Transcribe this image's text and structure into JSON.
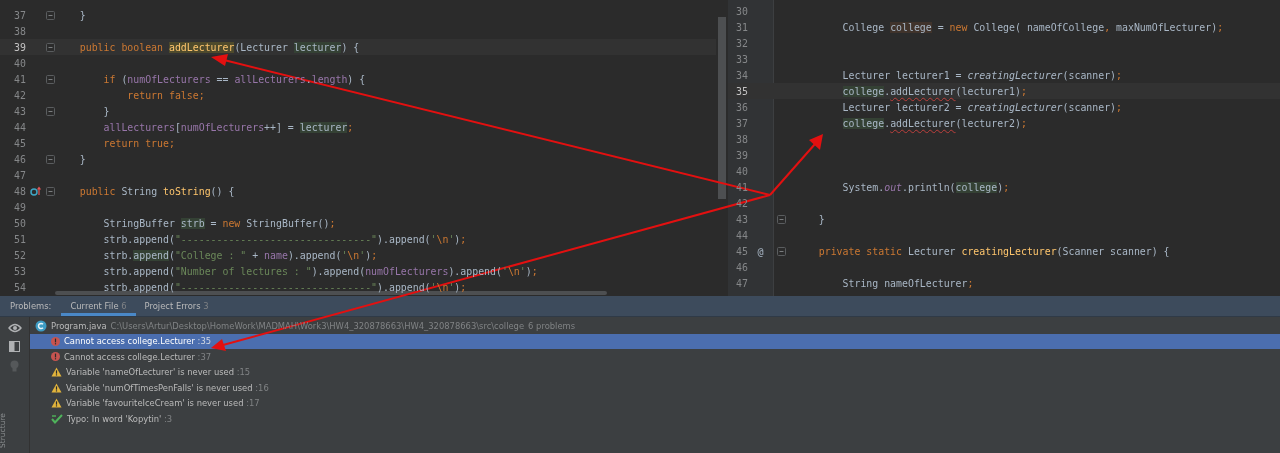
{
  "left_editor": {
    "lines": [
      {
        "number": "37",
        "current": false,
        "fold": true,
        "tokens": [
          {
            "t": "    }",
            "kind": "p"
          }
        ]
      },
      {
        "number": "38",
        "current": false,
        "fold": false
      },
      {
        "number": "39",
        "current": true,
        "fold": true,
        "tokens": [
          {
            "t": "    public boolean ",
            "kind": "kw"
          },
          {
            "t": "addLecturer",
            "kind": "mdecl"
          },
          {
            "t": "(Lecturer ",
            "kind": "p"
          },
          {
            "t": "lecturer",
            "kind": "usage"
          },
          {
            "t": ") {",
            "kind": "p"
          }
        ]
      },
      {
        "number": "40",
        "current": false,
        "fold": false
      },
      {
        "number": "41",
        "current": false,
        "fold": true,
        "tokens": [
          {
            "t": "        if ",
            "kind": "kw"
          },
          {
            "t": "(",
            "kind": "p"
          },
          {
            "t": "numOfLecturers",
            "kind": "f"
          },
          {
            "t": " == ",
            "kind": "p"
          },
          {
            "t": "allLecturers",
            "kind": "f"
          },
          {
            "t": ".",
            "kind": "p"
          },
          {
            "t": "length",
            "kind": "f"
          },
          {
            "t": ") {",
            "kind": "p"
          }
        ]
      },
      {
        "number": "42",
        "current": false,
        "fold": false,
        "tokens": [
          {
            "t": "            return false;",
            "kind": "kw"
          }
        ]
      },
      {
        "number": "43",
        "current": false,
        "fold": true,
        "tokens": [
          {
            "t": "        }",
            "kind": "p"
          }
        ]
      },
      {
        "number": "44",
        "current": false,
        "fold": false,
        "tokens": [
          {
            "t": "        allLecturers",
            "kind": "f"
          },
          {
            "t": "[",
            "kind": "p"
          },
          {
            "t": "numOfLecturers",
            "kind": "f"
          },
          {
            "t": "++] = ",
            "kind": "p"
          },
          {
            "t": "lecturer",
            "kind": "usage"
          },
          {
            "t": ";",
            "kind": "kw"
          }
        ]
      },
      {
        "number": "45",
        "current": false,
        "fold": false,
        "tokens": [
          {
            "t": "        return true;",
            "kind": "kw"
          }
        ]
      },
      {
        "number": "46",
        "current": false,
        "fold": true,
        "tokens": [
          {
            "t": "    }",
            "kind": "p"
          }
        ]
      },
      {
        "number": "47",
        "current": false,
        "fold": false
      },
      {
        "number": "48",
        "current": false,
        "fold": true,
        "gutter": {
          "kind": "override"
        },
        "tokens": [
          {
            "t": "    public ",
            "kind": "kw"
          },
          {
            "t": "String ",
            "kind": "p"
          },
          {
            "t": "toString",
            "kind": "m"
          },
          {
            "t": "() {",
            "kind": "p"
          }
        ]
      },
      {
        "number": "49",
        "current": false,
        "fold": false
      },
      {
        "number": "50",
        "current": false,
        "fold": false,
        "tokens": [
          {
            "t": "        StringBuffer ",
            "kind": "p"
          },
          {
            "t": "strb",
            "kind": "usage"
          },
          {
            "t": " = ",
            "kind": "p"
          },
          {
            "t": "new ",
            "kind": "kw"
          },
          {
            "t": "StringBuffer()",
            "kind": "p"
          },
          {
            "t": ";",
            "kind": "kw"
          }
        ]
      },
      {
        "number": "51",
        "current": false,
        "fold": false,
        "tokens": [
          {
            "t": "        strb.append(",
            "kind": "p"
          },
          {
            "t": "\"--------------------------------\"",
            "kind": "s"
          },
          {
            "t": ").append(",
            "kind": "p"
          },
          {
            "t": "'",
            "kind": "s"
          },
          {
            "t": "\\n",
            "kind": "kw"
          },
          {
            "t": "'",
            "kind": "s"
          },
          {
            "t": ")",
            "kind": "p"
          },
          {
            "t": ";",
            "kind": "kw"
          }
        ]
      },
      {
        "number": "52",
        "current": false,
        "fold": false,
        "tokens": [
          {
            "t": "        strb.",
            "kind": "p"
          },
          {
            "t": "append",
            "kind": "usage"
          },
          {
            "t": "(",
            "kind": "p"
          },
          {
            "t": "\"College : \"",
            "kind": "s"
          },
          {
            "t": " + ",
            "kind": "p"
          },
          {
            "t": "name",
            "kind": "f"
          },
          {
            "t": ").append(",
            "kind": "p"
          },
          {
            "t": "'",
            "kind": "s"
          },
          {
            "t": "\\n",
            "kind": "kw"
          },
          {
            "t": "'",
            "kind": "s"
          },
          {
            "t": ")",
            "kind": "p"
          },
          {
            "t": ";",
            "kind": "kw"
          }
        ]
      },
      {
        "number": "53",
        "current": false,
        "fold": false,
        "tokens": [
          {
            "t": "        strb.append(",
            "kind": "p"
          },
          {
            "t": "\"Number of lectures : \"",
            "kind": "s"
          },
          {
            "t": ").append(",
            "kind": "p"
          },
          {
            "t": "numOfLecturers",
            "kind": "f"
          },
          {
            "t": ").append(",
            "kind": "p"
          },
          {
            "t": "'",
            "kind": "s"
          },
          {
            "t": "\\n",
            "kind": "kw"
          },
          {
            "t": "'",
            "kind": "s"
          },
          {
            "t": ")",
            "kind": "p"
          },
          {
            "t": ";",
            "kind": "kw"
          }
        ]
      },
      {
        "number": "54",
        "current": false,
        "fold": false,
        "tokens": [
          {
            "t": "        strb.append(",
            "kind": "p"
          },
          {
            "t": "\"--------------------------------\"",
            "kind": "s"
          },
          {
            "t": ").append(",
            "kind": "p"
          },
          {
            "t": "'",
            "kind": "s"
          },
          {
            "t": "\\n",
            "kind": "kw"
          },
          {
            "t": "'",
            "kind": "s"
          },
          {
            "t": ")",
            "kind": "p"
          },
          {
            "t": ";",
            "kind": "kw"
          }
        ]
      }
    ]
  },
  "right_editor": {
    "lines": [
      {
        "number": "30",
        "current": false,
        "fold": false
      },
      {
        "number": "31",
        "current": false,
        "fold": false,
        "tokens": [
          {
            "t": "        College ",
            "kind": "p"
          },
          {
            "t": "college",
            "kind": "write"
          },
          {
            "t": " = ",
            "kind": "p"
          },
          {
            "t": "new ",
            "kind": "kw"
          },
          {
            "t": "College( nameOfCollege",
            "kind": "p"
          },
          {
            "t": ", ",
            "kind": "kw"
          },
          {
            "t": "maxNumOfLecturer)",
            "kind": "p"
          },
          {
            "t": ";",
            "kind": "kw"
          }
        ]
      },
      {
        "number": "32",
        "current": false,
        "fold": false
      },
      {
        "number": "33",
        "current": false,
        "fold": false
      },
      {
        "number": "34",
        "current": false,
        "fold": false,
        "tokens": [
          {
            "t": "        Lecturer lecturer1 = ",
            "kind": "p"
          },
          {
            "t": "creatingLecturer",
            "kind": "i"
          },
          {
            "t": "(scanner)",
            "kind": "p"
          },
          {
            "t": ";",
            "kind": "kw"
          }
        ]
      },
      {
        "number": "35",
        "current": true,
        "fold": false,
        "tokens": [
          {
            "t": "        college",
            "kind": "usage"
          },
          {
            "t": ".",
            "kind": "p"
          },
          {
            "t": "addLecturer",
            "kind": "err"
          },
          {
            "t": "(lecturer1)",
            "kind": "p"
          },
          {
            "t": ";",
            "kind": "kw"
          }
        ]
      },
      {
        "number": "36",
        "current": false,
        "fold": false,
        "tokens": [
          {
            "t": "        Lecturer lecturer2 = ",
            "kind": "p"
          },
          {
            "t": "creatingLecturer",
            "kind": "i"
          },
          {
            "t": "(scanner)",
            "kind": "p"
          },
          {
            "t": ";",
            "kind": "kw"
          }
        ]
      },
      {
        "number": "37",
        "current": false,
        "fold": false,
        "tokens": [
          {
            "t": "        college",
            "kind": "usage"
          },
          {
            "t": ".",
            "kind": "p"
          },
          {
            "t": "addLecturer",
            "kind": "err"
          },
          {
            "t": "(lecturer2)",
            "kind": "p"
          },
          {
            "t": ";",
            "kind": "kw"
          }
        ]
      },
      {
        "number": "38",
        "current": false,
        "fold": false
      },
      {
        "number": "39",
        "current": false,
        "fold": false
      },
      {
        "number": "40",
        "current": false,
        "fold": false
      },
      {
        "number": "41",
        "current": false,
        "fold": false,
        "tokens": [
          {
            "t": "        System.",
            "kind": "p"
          },
          {
            "t": "out",
            "kind": "fi"
          },
          {
            "t": ".println(",
            "kind": "p"
          },
          {
            "t": "college",
            "kind": "usage"
          },
          {
            "t": ")",
            "kind": "p"
          },
          {
            "t": ";",
            "kind": "kw"
          }
        ]
      },
      {
        "number": "42",
        "current": false,
        "fold": false
      },
      {
        "number": "43",
        "current": false,
        "fold": true,
        "tokens": [
          {
            "t": "    }",
            "kind": "p"
          }
        ]
      },
      {
        "number": "44",
        "current": false,
        "fold": false
      },
      {
        "number": "45",
        "current": false,
        "fold": true,
        "gutter": {
          "kind": "at",
          "text": "@"
        },
        "tokens": [
          {
            "t": "    private static ",
            "kind": "kw"
          },
          {
            "t": "Lecturer ",
            "kind": "p"
          },
          {
            "t": "creatingLecturer",
            "kind": "m"
          },
          {
            "t": "(Scanner scanner) {",
            "kind": "p"
          }
        ]
      },
      {
        "number": "46",
        "current": false,
        "fold": false
      },
      {
        "number": "47",
        "current": false,
        "fold": false,
        "tokens": [
          {
            "t": "        String nameOfLecturer",
            "kind": "p"
          },
          {
            "t": ";",
            "kind": "kw"
          }
        ]
      }
    ]
  },
  "problems": {
    "label": "Problems:",
    "tabs": [
      {
        "label": "Current File",
        "count": "6",
        "selected": true
      },
      {
        "label": "Project Errors",
        "count": "3",
        "selected": false
      }
    ],
    "file": {
      "name": "Program.java",
      "path": "C:\\Users\\Artur\\Desktop\\HomeWork\\MADMAH\\Work3\\HW4_320878663\\HW4_320878663\\src\\college",
      "summary": "6 problems"
    },
    "items": [
      {
        "kind": "error",
        "message": "Cannot access college.Lecturer",
        "line": ":35",
        "selected": true
      },
      {
        "kind": "error",
        "message": "Cannot access college.Lecturer",
        "line": ":37",
        "selected": false
      },
      {
        "kind": "warning",
        "message": "Variable 'nameOfLecturer' is never used",
        "line": ":15",
        "selected": false
      },
      {
        "kind": "warning",
        "message": "Variable 'numOfTimesPenFalls' is never used",
        "line": ":16",
        "selected": false
      },
      {
        "kind": "warning",
        "message": "Variable 'favouriteIceCream' is never used",
        "line": ":17",
        "selected": false
      },
      {
        "kind": "typo",
        "message": "Typo: In word 'Kopytin'",
        "line": ":3",
        "selected": false
      }
    ],
    "side_label": "Structure"
  }
}
